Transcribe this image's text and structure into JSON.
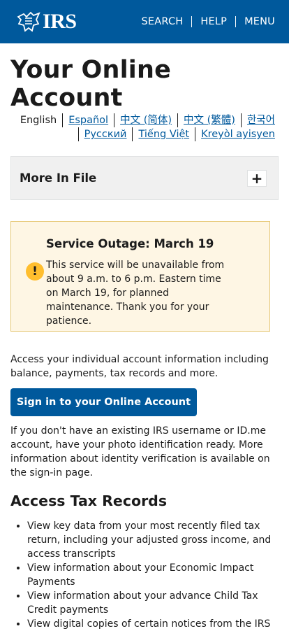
{
  "header": {
    "logo_text": "IRS",
    "nav": [
      "SEARCH",
      "HELP",
      "MENU"
    ]
  },
  "page_title": "Your Online Account",
  "languages": {
    "row1": [
      "English",
      "Español",
      "中文 (简体)",
      "中文 (繁體)",
      "한국어"
    ],
    "row2": [
      "Русский",
      "Tiếng Việt",
      "Kreyòl ayisyen"
    ]
  },
  "accordion": {
    "title": "More In File",
    "toggle": "+"
  },
  "alert": {
    "icon": "!",
    "title": "Service Outage: March 19",
    "body": "This service will be unavailable from about 9 a.m. to 6 p.m. Eastern time on March 19, for planned maintenance. Thank you for your patience."
  },
  "intro": "Access your individual account information including balance, payments, tax records and more.",
  "signin_label": "Sign in to your Online Account",
  "id_paragraph": "If you don't have an existing IRS username or ID.me account, have your photo identification ready. More information about identity verification is available on the sign-in page.",
  "section_title": "Access Tax Records",
  "bullets": [
    "View key data from your most recently filed tax return, including your adjusted gross income, and access transcripts",
    "View information about your Economic Impact Payments",
    "View information about your advance Child Tax Credit payments",
    "View digital copies of certain notices from the IRS"
  ],
  "colors": {
    "brand": "#00599c",
    "alert_bg": "#fef6e4",
    "alert_icon": "#ffbe2e"
  }
}
